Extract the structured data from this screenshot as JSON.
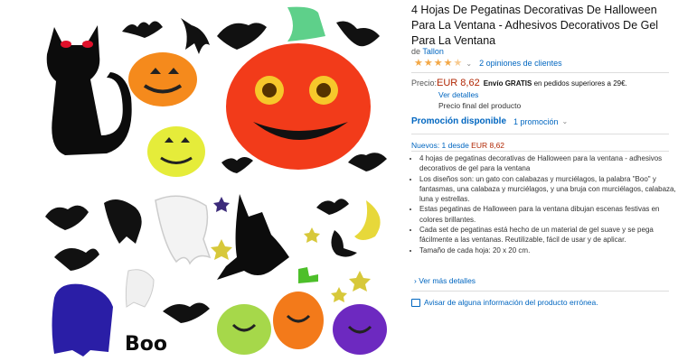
{
  "product": {
    "title": "4 Hojas De Pegatinas Decorativas De Halloween Para La Ventana - Adhesivos Decorativos De Gel Para La Ventana",
    "brand_prefix": "de",
    "brand": "Tallon",
    "rating_stars": 4.5,
    "reviews_label": "2 opiniones de clientes"
  },
  "pricing": {
    "price_label": "Precio:",
    "price": "EUR 8,62",
    "shipping_bold": "Envío GRATIS",
    "shipping_rest": "en pedidos superiores a 29€.",
    "details_link": "Ver detalles",
    "final_price": "Precio final del producto"
  },
  "promotion": {
    "label": "Promoción disponible",
    "count": "1 promoción"
  },
  "offers": {
    "new_label": "Nuevos: 1 desde",
    "new_price": "EUR 8,62"
  },
  "bullets": [
    "4 hojas de pegatinas decorativas de Halloween para la ventana - adhesivos decorativos de gel para la ventana",
    "Los diseños son: un gato con calabazas y murciélagos, la palabra \"Boo\" y fantasmas, una calabaza y murciélagos, y una bruja con murciélagos, calabaza, luna y estrellas.",
    "Estas pegatinas de Halloween para la ventana dibujan escenas festivas en colores brillantes.",
    "Cada set de pegatinas está hecho de un material de gel suave y se pega fácilmente a las ventanas. Reutilizable, fácil de usar y de aplicar.",
    "Tamaño de cada hoja: 20 x 20 cm."
  ],
  "more_details": "Ver más detalles",
  "report_link": "Avisar de alguna información del producto errónea.",
  "image": {
    "boo_text": "Boo"
  },
  "colors": {
    "link": "#0066c0",
    "price": "#b12704",
    "star": "#f3a847"
  }
}
